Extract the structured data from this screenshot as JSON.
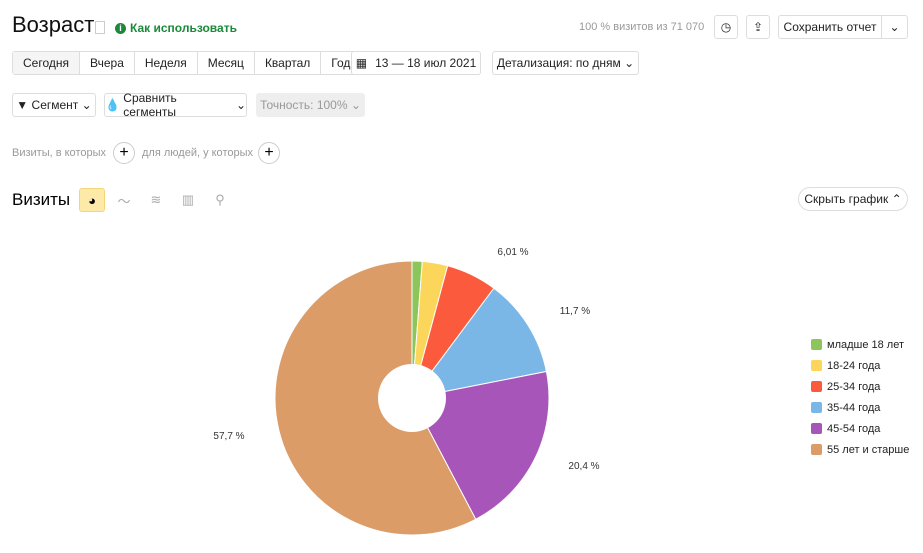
{
  "header": {
    "title": "Возраст",
    "how_to": "Как использовать",
    "visits_info": "100 % визитов из 71 070",
    "save_report": "Сохранить отчет"
  },
  "period": {
    "items": [
      "Сегодня",
      "Вчера",
      "Неделя",
      "Месяц",
      "Квартал",
      "Год"
    ],
    "selected": "Сегодня",
    "date_range": "13 — 18 июл 2021",
    "detail": "Детализация: по дням"
  },
  "filters": {
    "segment": "Сегмент",
    "compare": "Сравнить сегменты",
    "accuracy": "Точность: 100%"
  },
  "conditions": {
    "visits_label": "Визиты, в которых",
    "people_label": "для людей, у которых"
  },
  "chart_section": {
    "title": "Визиты",
    "hide_chart": "Скрыть график",
    "view_icons": [
      "pie-chart-icon",
      "line-chart-icon",
      "area-chart-icon",
      "bar-chart-icon",
      "map-icon"
    ],
    "selected_view": "pie-chart-icon"
  },
  "chart_data": {
    "type": "pie",
    "donut": true,
    "categories": [
      "младше 18 лет",
      "18-24 года",
      "25-34 года",
      "35-44 года",
      "45-54 года",
      "55 лет и старше"
    ],
    "values": [
      1.2,
      2.99,
      6.01,
      11.7,
      20.4,
      57.7
    ],
    "data_labels": [
      "",
      "",
      "6,01 %",
      "11,7 %",
      "20,4 %",
      "57,7 %"
    ],
    "colors": [
      "#8cc65a",
      "#fcd65a",
      "#fb5a3c",
      "#7ab6e6",
      "#a855b9",
      "#db9c68"
    ],
    "legend_position": "right"
  }
}
